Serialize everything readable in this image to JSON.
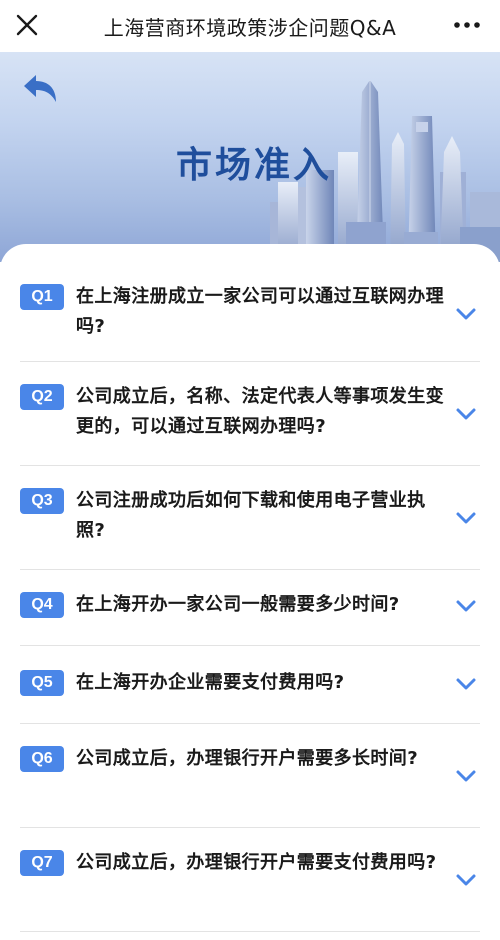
{
  "header": {
    "title": "上海营商环境政策涉企问题Q&A"
  },
  "banner": {
    "heading": "市场准入"
  },
  "faq": [
    {
      "badge": "Q1",
      "question": "在上海注册成立一家公司可以通过互联网办理吗?"
    },
    {
      "badge": "Q2",
      "question": "公司成立后，名称、法定代表人等事项发生变更的，可以通过互联网办理吗?"
    },
    {
      "badge": "Q3",
      "question": "公司注册成功后如何下载和使用电子营业执照?"
    },
    {
      "badge": "Q4",
      "question": "在上海开办一家公司一般需要多少时间?"
    },
    {
      "badge": "Q5",
      "question": "在上海开办企业需要支付费用吗?"
    },
    {
      "badge": "Q6",
      "question": "公司成立后，办理银行开户需要多长时间?"
    },
    {
      "badge": "Q7",
      "question": "公司成立后，办理银行开户需要支付费用吗?"
    }
  ],
  "colors": {
    "badge": "#4a86e8",
    "heading": "#1f4e9c",
    "chevron": "#4a86e8"
  }
}
